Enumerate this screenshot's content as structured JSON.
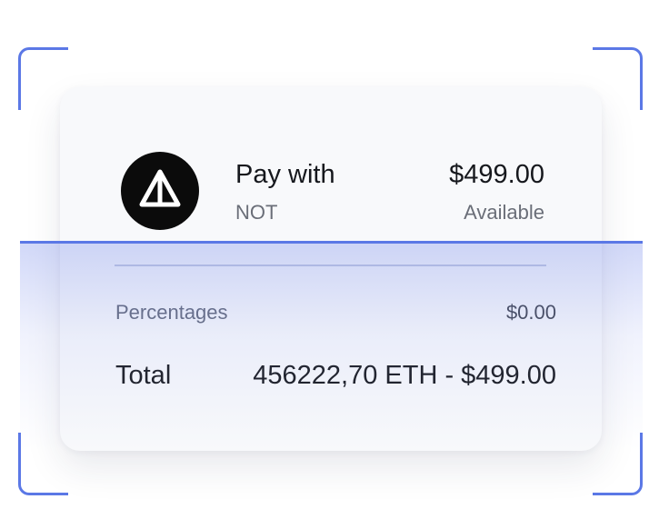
{
  "payment": {
    "title": "Pay with",
    "token": "NOT",
    "amount": "$499.00",
    "amount_caption": "Available",
    "logo_icon": "warning-triangle-icon"
  },
  "summary": {
    "percentages_label": "Percentages",
    "percentages_value": "$0.00",
    "total_label": "Total",
    "total_value": "456222,70 ETH - $499.00"
  },
  "colors": {
    "accent": "#5b78e6",
    "card_bg": "#f8f9fb",
    "text_primary": "#16181d",
    "text_secondary": "#6a6e78",
    "logo_bg": "#0b0b0b"
  }
}
